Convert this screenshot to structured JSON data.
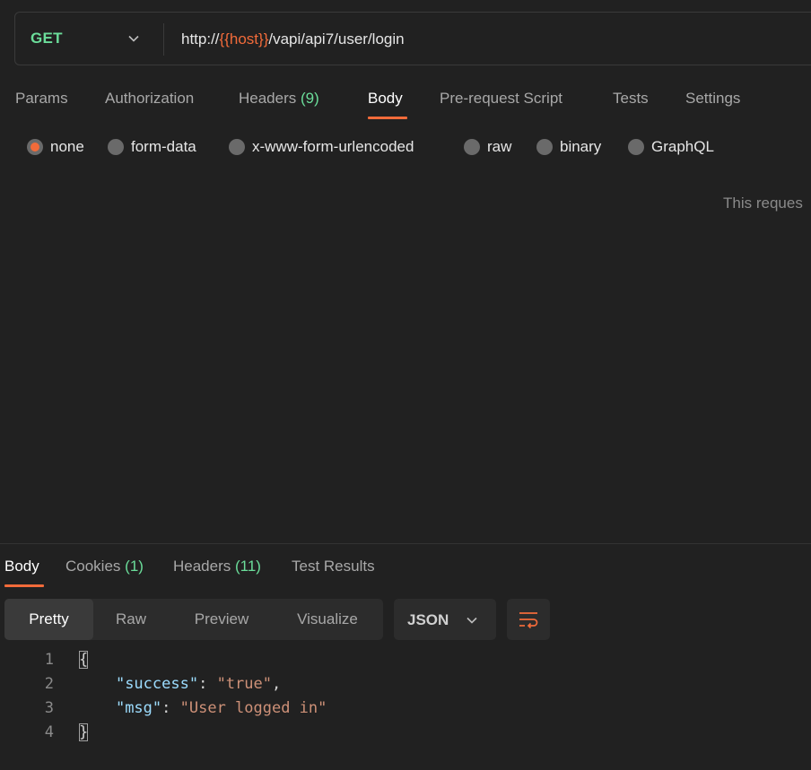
{
  "request": {
    "method": "GET",
    "url_prefix": "http://",
    "url_variable": "{{host}}",
    "url_suffix": "/vapi/api7/user/login"
  },
  "request_tabs": [
    {
      "label": "Params"
    },
    {
      "label": "Authorization"
    },
    {
      "label": "Headers",
      "count": "(9)"
    },
    {
      "label": "Body",
      "active": true
    },
    {
      "label": "Pre-request Script"
    },
    {
      "label": "Tests"
    },
    {
      "label": "Settings"
    }
  ],
  "body_types": [
    {
      "label": "none",
      "selected": true
    },
    {
      "label": "form-data"
    },
    {
      "label": "x-www-form-urlencoded"
    },
    {
      "label": "raw"
    },
    {
      "label": "binary"
    },
    {
      "label": "GraphQL"
    }
  ],
  "empty_body_note": "This reques",
  "response_tabs": [
    {
      "label": "Body",
      "active": true
    },
    {
      "label": "Cookies",
      "count": "(1)"
    },
    {
      "label": "Headers",
      "count": "(11)"
    },
    {
      "label": "Test Results"
    }
  ],
  "format_buttons": [
    {
      "label": "Pretty",
      "active": true
    },
    {
      "label": "Raw"
    },
    {
      "label": "Preview"
    },
    {
      "label": "Visualize"
    }
  ],
  "language": "JSON",
  "code": {
    "line_numbers": [
      "1",
      "2",
      "3",
      "4"
    ],
    "open_brace": "{",
    "close_brace": "}",
    "line2_key": "\"success\"",
    "line2_sep": ": ",
    "line2_value": "\"true\"",
    "line2_end": ",",
    "line3_key": "\"msg\"",
    "line3_sep": ": ",
    "line3_value": "\"User logged in\""
  },
  "colors": {
    "accent": "#f26b3a",
    "method_get": "#6bdd9a",
    "count": "#6bdd9a"
  },
  "icons": [
    "chevron-down-icon",
    "wrap-lines-icon"
  ]
}
